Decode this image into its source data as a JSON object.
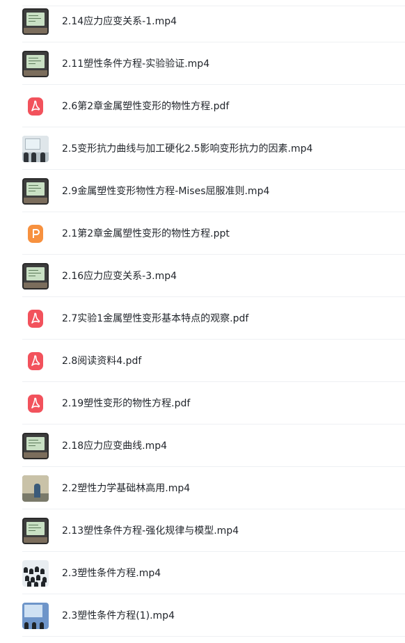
{
  "files": [
    {
      "name": "2.14应力应变关系-1.mp4",
      "thumb": "video",
      "icon": "video-thumbnail"
    },
    {
      "name": "2.11塑性条件方程-实验验证.mp4",
      "thumb": "video",
      "icon": "video-thumbnail"
    },
    {
      "name": "2.6第2章金属塑性变形的物性方程.pdf",
      "thumb": "pdf",
      "icon": "pdf-icon"
    },
    {
      "name": "2.5变形抗力曲线与加工硬化2.5影响变形抗力的因素.mp4",
      "thumb": "room",
      "icon": "video-thumbnail"
    },
    {
      "name": "2.9金属塑性变形物性方程-Mises屈服准则.mp4",
      "thumb": "video",
      "icon": "video-thumbnail"
    },
    {
      "name": "2.1第2章金属塑性变形的物性方程.ppt",
      "thumb": "ppt",
      "icon": "ppt-icon"
    },
    {
      "name": "2.16应力应变关系-3.mp4",
      "thumb": "video",
      "icon": "video-thumbnail"
    },
    {
      "name": "2.7实验1金属塑性变形基本特点的观察.pdf",
      "thumb": "pdf",
      "icon": "pdf-icon"
    },
    {
      "name": "2.8阅读资料4.pdf",
      "thumb": "pdf",
      "icon": "pdf-icon"
    },
    {
      "name": "2.19塑性变形的物性方程.pdf",
      "thumb": "pdf",
      "icon": "pdf-icon"
    },
    {
      "name": "2.18应力应变曲线.mp4",
      "thumb": "video",
      "icon": "video-thumbnail"
    },
    {
      "name": "2.2塑性力学基础林高用.mp4",
      "thumb": "class2",
      "icon": "video-thumbnail"
    },
    {
      "name": "2.13塑性条件方程-强化规律与模型.mp4",
      "thumb": "video",
      "icon": "video-thumbnail"
    },
    {
      "name": "2.3塑性条件方程.mp4",
      "thumb": "crowd",
      "icon": "video-thumbnail"
    },
    {
      "name": "2.3塑性条件方程(1).mp4",
      "thumb": "blue",
      "icon": "video-thumbnail"
    }
  ],
  "colors": {
    "pdf": "#f2525c",
    "ppt": "#f7913f",
    "divider": "#eef0f3",
    "text": "#1f2329"
  }
}
